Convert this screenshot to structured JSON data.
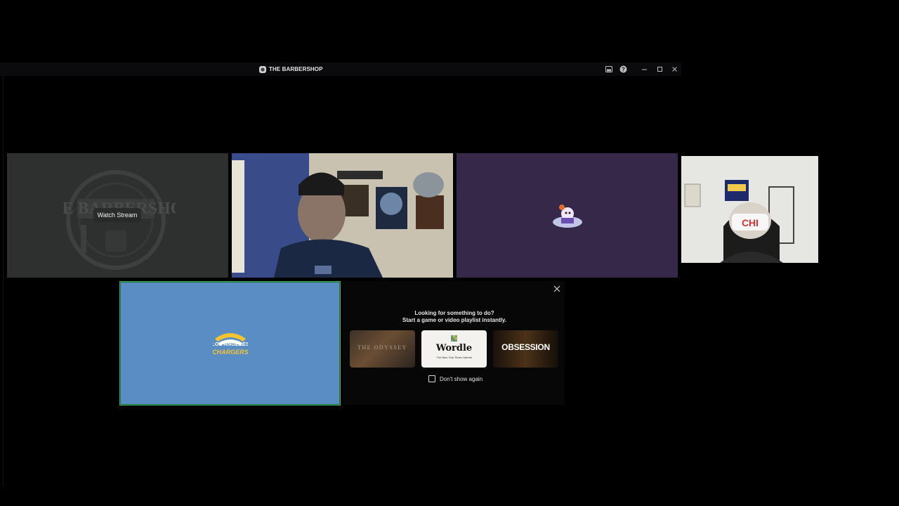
{
  "window": {
    "title": "THE BARBERSHOP",
    "icons": [
      "server-icon",
      "inbox-icon",
      "help-icon",
      "minimize-icon",
      "maximize-icon",
      "close-icon"
    ]
  },
  "tiles": {
    "barbershop": {
      "logo_text": "THE BARBERSHOP",
      "watch_label": "Watch Stream"
    },
    "chargers": {
      "logo_text_top": "LOS ANGELES",
      "logo_text_bottom": "CHARGERS"
    }
  },
  "activity": {
    "title": "Looking for something to do?",
    "subtitle": "Start a game or video playlist instantly.",
    "games": [
      {
        "name": "THE ODYSSEY"
      },
      {
        "name": "Wordle",
        "publisher": "The New York Times Games"
      },
      {
        "name": "OBSESSION"
      }
    ],
    "dont_show_label": "Don't show again",
    "dont_show_checked": false
  },
  "colors": {
    "background": "#000000",
    "titlebar": "#0b0b0d",
    "speaking_border": "#3fae5c",
    "avatar_tile": "#362849",
    "chargers_tile": "#5b8dc5"
  }
}
